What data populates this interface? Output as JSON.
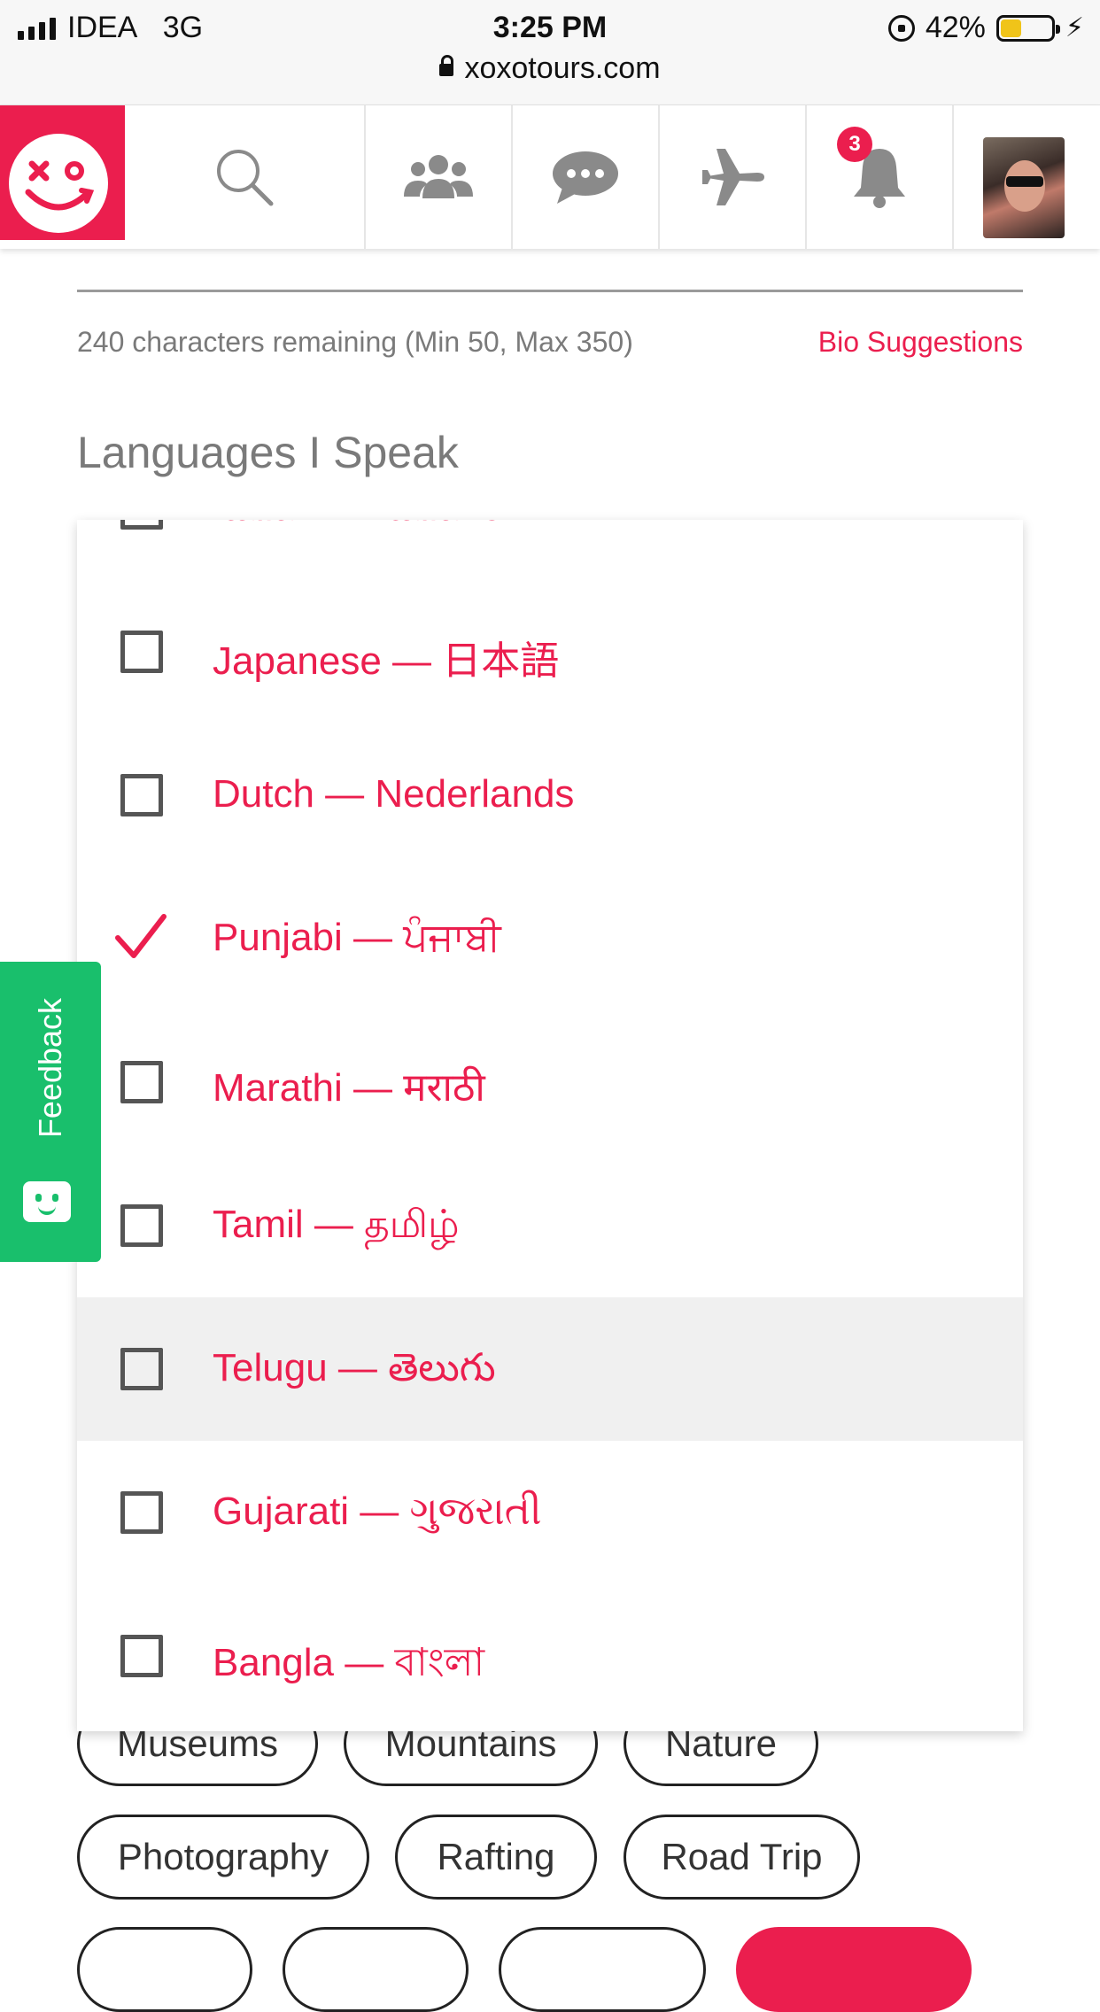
{
  "status_bar": {
    "carrier": "IDEA",
    "network": "3G",
    "time": "3:25 PM",
    "battery_percent": "42%",
    "battery_level": 0.42,
    "url": "xoxotours.com"
  },
  "navbar": {
    "notification_count": "3",
    "icons": [
      "logo-smiley-icon",
      "search-icon",
      "people-icon",
      "chat-icon",
      "airplane-icon",
      "bell-icon",
      "avatar"
    ],
    "brand_color": "#eb1e4e"
  },
  "bio": {
    "chars_remaining": "240 characters remaining (Min 50, Max 350)",
    "suggestions_link": "Bio Suggestions"
  },
  "languages": {
    "title": "Languages I Speak",
    "options": [
      {
        "label": "Italian — Italiano",
        "checked": false
      },
      {
        "label": "Japanese — 日本語",
        "checked": false
      },
      {
        "label": "Dutch — Nederlands",
        "checked": false
      },
      {
        "label": "Punjabi — ਪੰਜਾਬੀ",
        "checked": true
      },
      {
        "label": "Marathi — मराठी",
        "checked": false
      },
      {
        "label": "Tamil — தமிழ்",
        "checked": false
      },
      {
        "label": "Telugu — తెలుగు",
        "checked": false,
        "highlighted": true
      },
      {
        "label": "Gujarati — ગુજરાતી",
        "checked": false
      },
      {
        "label": "Bangla — বাংলা",
        "checked": false
      }
    ]
  },
  "interests": {
    "row1": [
      "Museums",
      "Mountains",
      "Nature"
    ],
    "row2": [
      "Photography",
      "Rafting",
      "Road Trip"
    ]
  },
  "feedback": {
    "label": "Feedback",
    "color": "#19bf6c"
  }
}
